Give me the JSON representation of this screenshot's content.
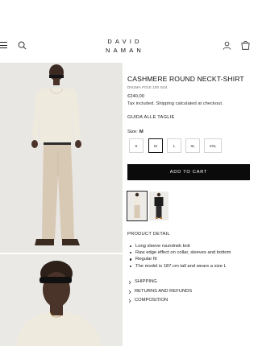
{
  "header": {
    "logo_line1": "DAVID",
    "logo_line2": "NAMAN",
    "menu_icon": "hamburger-icon",
    "search_icon": "search-icon",
    "account_icon": "user-icon",
    "cart_icon": "shopping-bag-icon"
  },
  "product": {
    "title": "CASHMERE ROUND NECKT-SHIRT",
    "sku": "DN1MA F010 100 S24",
    "price": "€240,00",
    "tax_note": "Tax included. Shipping calculated at checkout.",
    "size_guide": "GUIDA ALLE TAGLIE",
    "size_label": "Size:",
    "selected_size": "M",
    "sizes": [
      "S",
      "M",
      "L",
      "XL",
      "XXL"
    ],
    "add_to_cart": "ADD TO CART"
  },
  "details": {
    "title": "PRODUCT DETAIL",
    "items": [
      "Long sleeve roundnek knit",
      "Raw edge effect on collar, sleeves and bottom",
      "Regular fit",
      "The model is 187.cm tall and wears a size L"
    ]
  },
  "accordion": {
    "items": [
      "SHIPPING",
      "RETURNS AND REFUNDS",
      "COMPOSITION"
    ]
  },
  "colors": {
    "button_bg": "#0b0b0b",
    "image_bg": "#e9e7e4",
    "sweater_cream": "#efeade",
    "trouser_beige": "#d8c9b4"
  }
}
